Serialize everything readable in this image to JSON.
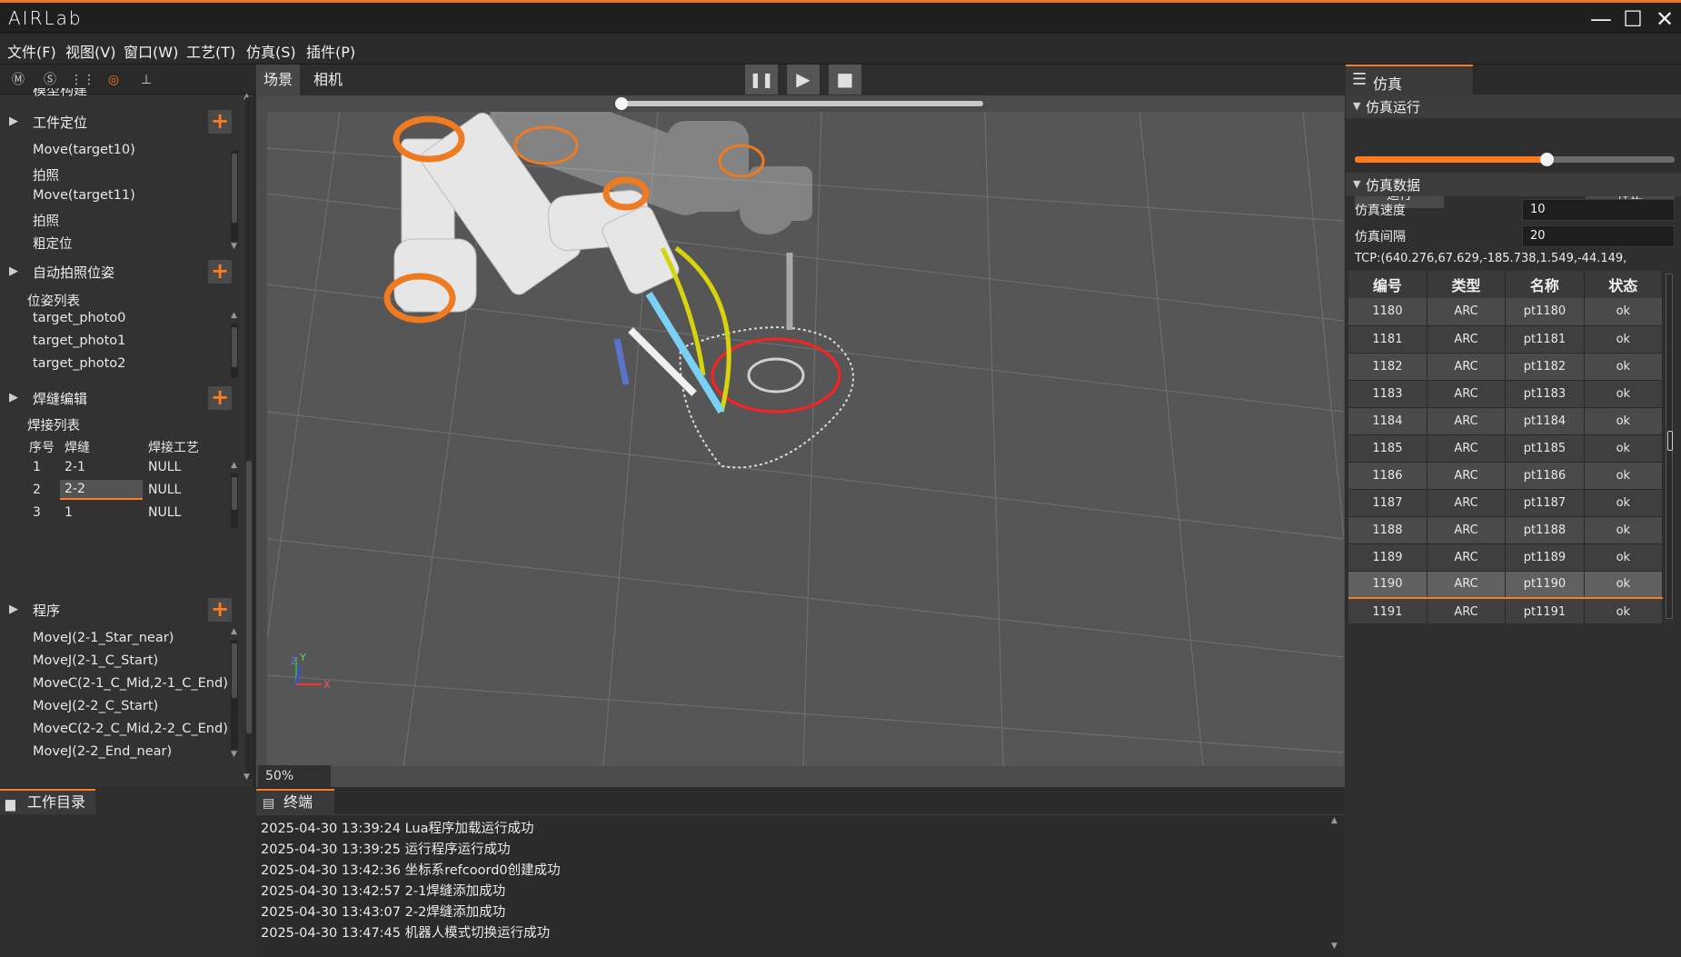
{
  "app": {
    "title": "AIRLab"
  },
  "window": {
    "minimize": "—",
    "maximize": "☐",
    "close": "✕"
  },
  "menu": [
    "文件(F)",
    "视图(V)",
    "窗口(W)",
    "工艺(T)",
    "仿真(S)",
    "插件(P)"
  ],
  "left_toolbar": [
    "Ⓜ",
    "Ⓢ",
    "⋮⋮",
    "◎",
    "⊥"
  ],
  "left": {
    "cut_header": "模型构建",
    "workpiece_title": "工件定位",
    "workpiece_items": [
      "Move(target10)",
      "拍照",
      "Move(target11)",
      "拍照",
      "粗定位"
    ],
    "auto_title": "自动拍照位姿",
    "pose_list_label": "位姿列表",
    "pose_items": [
      "target_photo0",
      "target_photo1",
      "target_photo2"
    ],
    "weld_title": "焊缝编辑",
    "weld_list_label": "焊接列表",
    "weld_headers": [
      "序号",
      "焊缝",
      "焊接工艺"
    ],
    "weld_rows": [
      {
        "no": "1",
        "seam": "2-1",
        "process": "NULL"
      },
      {
        "no": "2",
        "seam": "2-2",
        "process": "NULL"
      },
      {
        "no": "3",
        "seam": "1",
        "process": "NULL"
      }
    ],
    "program_title": "程序",
    "program_items": [
      "MoveJ(2-1_Star_near)",
      "MoveJ(2-1_C_Start)",
      "MoveC(2-1_C_Mid,2-1_C_End)",
      "MoveJ(2-2_C_Start)",
      "MoveC(2-2_C_Mid,2-2_C_End)",
      "MoveJ(2-2_End_near)"
    ],
    "plus": "+"
  },
  "viewport": {
    "tabs": [
      "场景",
      "相机"
    ],
    "controls": {
      "pause": "❚❚",
      "play": "▶",
      "stop": "■"
    },
    "timeline_progress": 0,
    "zoom": "50%",
    "axes": {
      "x": "X",
      "y": "Y",
      "z": "Z"
    }
  },
  "sim": {
    "panel_title": "仿真",
    "run_section": "仿真运行",
    "run_button": "运行",
    "stop_button": "停止",
    "slider_value": 0.6,
    "data_section": "仿真数据",
    "speed_label": "仿真速度",
    "speed_value": "10",
    "interval_label": "仿真间隔",
    "interval_value": "20",
    "tcp": "TCP:(640.276,67.629,-185.738,1.549,-44.149,",
    "table_headers": [
      "编号",
      "类型",
      "名称",
      "状态"
    ],
    "rows": [
      {
        "id": "1180",
        "type": "ARC",
        "name": "pt1180",
        "status": "ok"
      },
      {
        "id": "1181",
        "type": "ARC",
        "name": "pt1181",
        "status": "ok"
      },
      {
        "id": "1182",
        "type": "ARC",
        "name": "pt1182",
        "status": "ok"
      },
      {
        "id": "1183",
        "type": "ARC",
        "name": "pt1183",
        "status": "ok"
      },
      {
        "id": "1184",
        "type": "ARC",
        "name": "pt1184",
        "status": "ok"
      },
      {
        "id": "1185",
        "type": "ARC",
        "name": "pt1185",
        "status": "ok"
      },
      {
        "id": "1186",
        "type": "ARC",
        "name": "pt1186",
        "status": "ok"
      },
      {
        "id": "1187",
        "type": "ARC",
        "name": "pt1187",
        "status": "ok"
      },
      {
        "id": "1188",
        "type": "ARC",
        "name": "pt1188",
        "status": "ok"
      },
      {
        "id": "1189",
        "type": "ARC",
        "name": "pt1189",
        "status": "ok"
      },
      {
        "id": "1190",
        "type": "ARC",
        "name": "pt1190",
        "status": "ok"
      },
      {
        "id": "1191",
        "type": "ARC",
        "name": "pt1191",
        "status": "ok"
      }
    ]
  },
  "bottom": {
    "workdir_tab": "工作目录",
    "terminal_tab": "终端",
    "logs": [
      "2025-04-30 13:39:24 Lua程序加载运行成功",
      "2025-04-30 13:39:25 运行程序运行成功",
      "2025-04-30 13:42:36 坐标系refcoord0创建成功",
      "2025-04-30 13:42:57 2-1焊缝添加成功",
      "2025-04-30 13:43:07 2-2焊缝添加成功",
      "2025-04-30 13:47:45 机器人模式切换运行成功"
    ]
  },
  "colors": {
    "accent": "#ff7b1c",
    "bg": "#2d2d2d",
    "panel": "#323232",
    "viewport": "#565656"
  }
}
